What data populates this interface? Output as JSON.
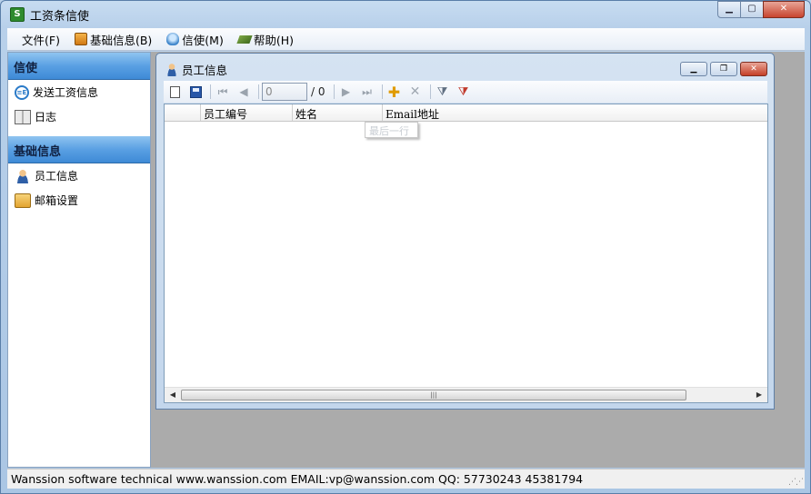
{
  "window": {
    "title": "工资条信使",
    "app_icon": "S"
  },
  "menu": [
    {
      "label": "文件(F)",
      "icon": ""
    },
    {
      "label": "基础信息(B)",
      "icon": "box-icon"
    },
    {
      "label": "信使(M)",
      "icon": "lightbulb-icon"
    },
    {
      "label": "帮助(H)",
      "icon": "book-icon"
    }
  ],
  "nav": {
    "section1": {
      "title": "信使",
      "items": [
        {
          "label": "发送工资信息",
          "icon": "send-email-icon"
        },
        {
          "label": "日志",
          "icon": "log-book-icon"
        }
      ]
    },
    "section2": {
      "title": "基础信息",
      "items": [
        {
          "label": "员工信息",
          "icon": "person-icon"
        },
        {
          "label": "邮箱设置",
          "icon": "mailbox-icon"
        }
      ]
    }
  },
  "child": {
    "title": "员工信息",
    "toolbar": {
      "position": "0",
      "of": "/ 0"
    },
    "grid": {
      "columns": [
        "员工编号",
        "姓名",
        "Email地址"
      ],
      "tooltip": "最后一行"
    }
  },
  "status": {
    "text": "Wanssion software technical  www.wanssion.com  EMAIL:vp@wanssion.com  QQ: 57730243 45381794"
  }
}
